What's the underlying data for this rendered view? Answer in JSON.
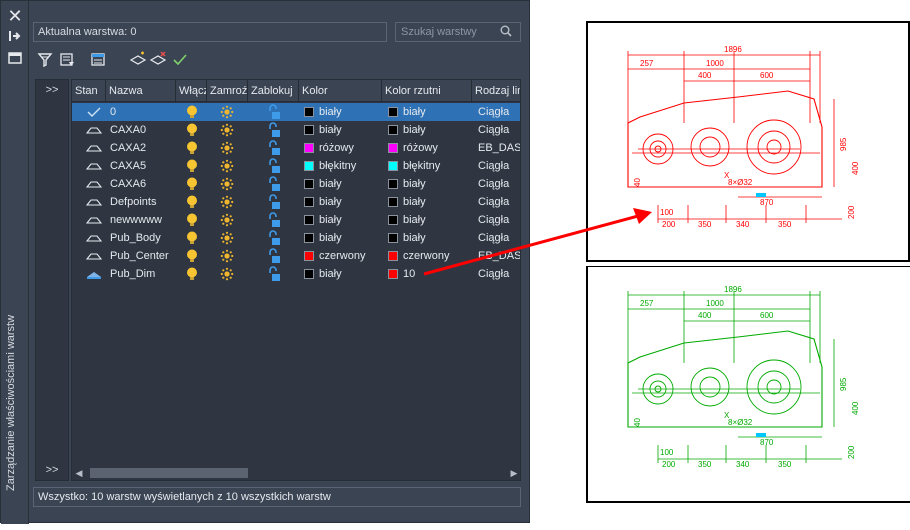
{
  "strip": {
    "close_icon": "close-icon",
    "title": "Zarządzanie właściwościami warstw"
  },
  "header": {
    "current_layer": "Aktualna warstwa: 0",
    "search_placeholder": "Szukaj warstwy"
  },
  "left_pane": {
    "expand_top": ">>",
    "expand_bottom": ">>"
  },
  "columns": [
    "Stan",
    "Nazwa",
    "Włącz",
    "Zamroź",
    "Zablokuj",
    "Kolor",
    "Kolor rzutni",
    "Rodzaj lin"
  ],
  "layers": [
    {
      "name": "0",
      "color": "biały",
      "vp_color": "biały",
      "linetype": "Ciągła",
      "swatch": "#000000",
      "vp_swatch": "#000000",
      "current": true
    },
    {
      "name": "CAXA0",
      "color": "biały",
      "vp_color": "biały",
      "linetype": "Ciągła",
      "swatch": "#000000",
      "vp_swatch": "#000000",
      "current": false
    },
    {
      "name": "CAXA2",
      "color": "różowy",
      "vp_color": "różowy",
      "linetype": "EB_DAS",
      "swatch": "#ff00ff",
      "vp_swatch": "#ff00ff",
      "current": false
    },
    {
      "name": "CAXA5",
      "color": "błękitny",
      "vp_color": "błękitny",
      "linetype": "Ciągła",
      "swatch": "#00ffff",
      "vp_swatch": "#00ffff",
      "current": false
    },
    {
      "name": "CAXA6",
      "color": "biały",
      "vp_color": "biały",
      "linetype": "Ciągła",
      "swatch": "#000000",
      "vp_swatch": "#000000",
      "current": false
    },
    {
      "name": "Defpoints",
      "color": "biały",
      "vp_color": "biały",
      "linetype": "Ciągła",
      "swatch": "#000000",
      "vp_swatch": "#000000",
      "current": false
    },
    {
      "name": "newwwww",
      "color": "biały",
      "vp_color": "biały",
      "linetype": "Ciągła",
      "swatch": "#000000",
      "vp_swatch": "#000000",
      "current": false
    },
    {
      "name": "Pub_Body",
      "color": "biały",
      "vp_color": "biały",
      "linetype": "Ciągła",
      "swatch": "#000000",
      "vp_swatch": "#000000",
      "current": false
    },
    {
      "name": "Pub_Center",
      "color": "czerwony",
      "vp_color": "czerwony",
      "linetype": "EB_DAS",
      "swatch": "#ff0000",
      "vp_swatch": "#ff0000",
      "current": false
    },
    {
      "name": "Pub_Dim",
      "color": "biały",
      "vp_color": "10",
      "linetype": "Ciągła",
      "swatch": "#000000",
      "vp_swatch": "#ff0000",
      "current": false
    }
  ],
  "status": "Wszystko:  10 warstw wyświetlanych z 10 wszystkich warstw",
  "drawing": {
    "top": {
      "color": "#ff0000",
      "dims": [
        "1896",
        "257",
        "1000",
        "400",
        "600",
        "985",
        "400",
        "40",
        "8×Ø32",
        "870",
        "200",
        "100",
        "200",
        "350",
        "340",
        "350",
        "X"
      ]
    },
    "bottom": {
      "color": "#00aa00",
      "dims": [
        "1896",
        "257",
        "1000",
        "400",
        "600",
        "985",
        "400",
        "40",
        "8×Ø32",
        "870",
        "200",
        "100",
        "200",
        "350",
        "340",
        "350",
        "X"
      ]
    },
    "arrow_color": "#ff0000"
  },
  "colors": {
    "panel": "#3b4453",
    "grid": "#2f3642",
    "selection": "#2e72b5",
    "bulb": "#f7c531",
    "sun": "#f0b52e",
    "lock": "#3d9be9"
  }
}
